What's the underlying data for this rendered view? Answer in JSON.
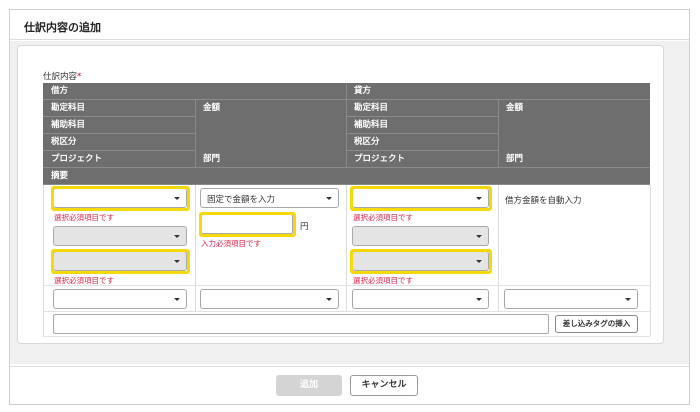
{
  "dialog": {
    "title": "仕訳内容の追加"
  },
  "section": {
    "label": "仕訳内容",
    "required_mark": "*"
  },
  "table": {
    "debit_header": "借方",
    "credit_header": "貸方",
    "debit": {
      "account": "勘定科目",
      "amount": "金額",
      "sub_account": "補助科目",
      "tax": "税区分",
      "project": "プロジェクト",
      "department": "部門"
    },
    "credit": {
      "account": "勘定科目",
      "amount": "金額",
      "sub_account": "補助科目",
      "tax": "税区分",
      "project": "プロジェクト",
      "department": "部門"
    },
    "memo": "摘要"
  },
  "form": {
    "amount_mode_select": "固定で金額を入力",
    "required_select_error": "選択必須項目です",
    "required_input_error": "入力必須項目です",
    "yen_unit": "円",
    "credit_amount_text": "借方金額を自動入力",
    "insert_tag_button": "差し込みタグの挿入"
  },
  "footer": {
    "add_button": "追加",
    "cancel_button": "キャンセル"
  },
  "colors": {
    "highlight": "#f5d90a",
    "error": "#e0224a",
    "header_bg": "#6e6e6e"
  }
}
